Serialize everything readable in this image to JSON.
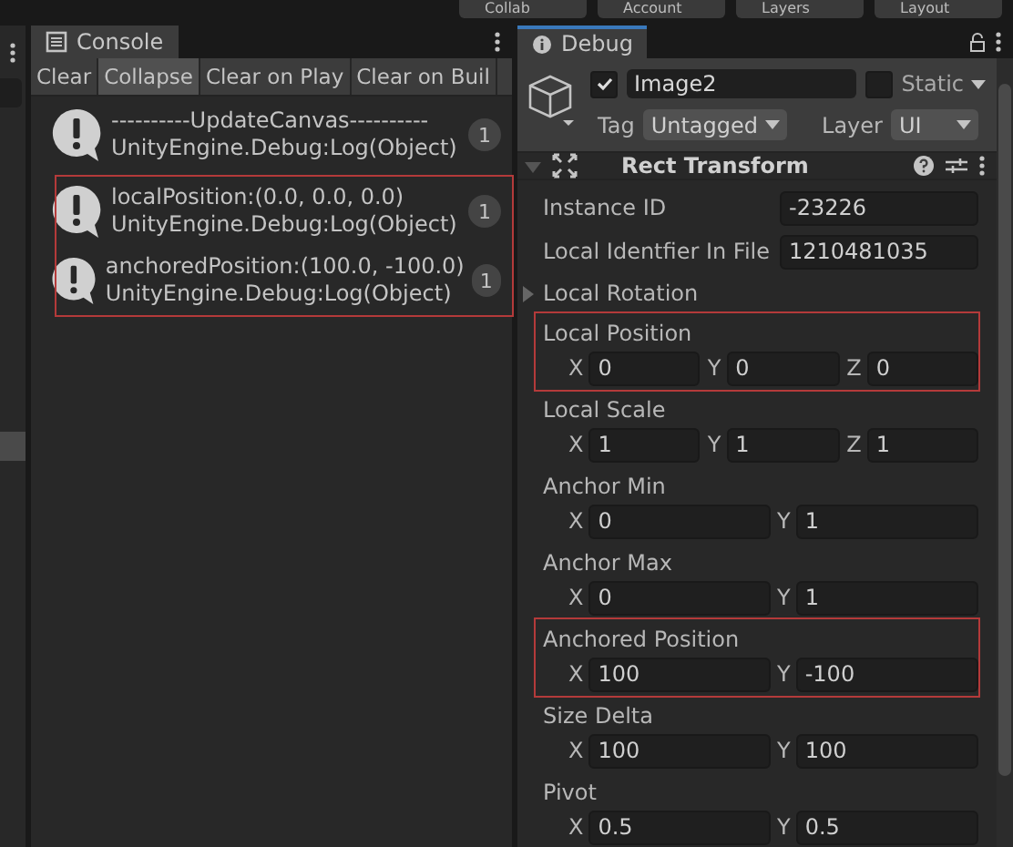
{
  "toolbar": {
    "buttons": [
      "Collab",
      "Account",
      "Layers",
      "Layout"
    ]
  },
  "console": {
    "tab": "Console",
    "buttons": [
      {
        "label": "Clear",
        "selected": false
      },
      {
        "label": "Collapse",
        "selected": true
      },
      {
        "label": "Clear on Play",
        "selected": false
      },
      {
        "label": "Clear on Buil",
        "selected": false
      }
    ],
    "groups": [
      {
        "highlighted": false,
        "entries": [
          {
            "message": "----------UpdateCanvas----------",
            "source": "UnityEngine.Debug:Log(Object)",
            "count": "1"
          }
        ]
      },
      {
        "highlighted": true,
        "entries": [
          {
            "message": "localPosition:(0.0, 0.0, 0.0)",
            "source": "UnityEngine.Debug:Log(Object)",
            "count": "1"
          },
          {
            "message": "anchoredPosition:(100.0, -100.0)",
            "source": "UnityEngine.Debug:Log(Object)",
            "count": "1"
          }
        ]
      }
    ]
  },
  "inspector": {
    "tab": "Debug",
    "object": {
      "active": true,
      "name": "Image2",
      "static": false,
      "static_label": "Static",
      "tag_label": "Tag",
      "tag": "Untagged",
      "layer_label": "Layer",
      "layer": "UI"
    },
    "component": {
      "title": "Rect Transform",
      "expanded": true,
      "properties": [
        {
          "kind": "single",
          "label": "Instance ID",
          "value": "-23226",
          "highlighted": false
        },
        {
          "kind": "single",
          "label": "Local Identfier In File",
          "value": "1210481035",
          "highlighted": false
        },
        {
          "kind": "foldout",
          "label": "Local Rotation",
          "highlighted": false
        },
        {
          "kind": "vector",
          "label": "Local Position",
          "highlighted": true,
          "fields": [
            {
              "axis": "X",
              "value": "0"
            },
            {
              "axis": "Y",
              "value": "0"
            },
            {
              "axis": "Z",
              "value": "0"
            }
          ]
        },
        {
          "kind": "vector",
          "label": "Local Scale",
          "highlighted": false,
          "fields": [
            {
              "axis": "X",
              "value": "1"
            },
            {
              "axis": "Y",
              "value": "1"
            },
            {
              "axis": "Z",
              "value": "1"
            }
          ]
        },
        {
          "kind": "vector",
          "label": "Anchor Min",
          "highlighted": false,
          "fields": [
            {
              "axis": "X",
              "value": "0"
            },
            {
              "axis": "Y",
              "value": "1"
            }
          ]
        },
        {
          "kind": "vector",
          "label": "Anchor Max",
          "highlighted": false,
          "fields": [
            {
              "axis": "X",
              "value": "0"
            },
            {
              "axis": "Y",
              "value": "1"
            }
          ]
        },
        {
          "kind": "vector",
          "label": "Anchored Position",
          "highlighted": true,
          "fields": [
            {
              "axis": "X",
              "value": "100"
            },
            {
              "axis": "Y",
              "value": "-100"
            }
          ]
        },
        {
          "kind": "vector",
          "label": "Size Delta",
          "highlighted": false,
          "fields": [
            {
              "axis": "X",
              "value": "100"
            },
            {
              "axis": "Y",
              "value": "100"
            }
          ]
        },
        {
          "kind": "vector",
          "label": "Pivot",
          "highlighted": false,
          "fields": [
            {
              "axis": "X",
              "value": "0.5"
            },
            {
              "axis": "Y",
              "value": "0.5"
            }
          ]
        }
      ]
    }
  }
}
